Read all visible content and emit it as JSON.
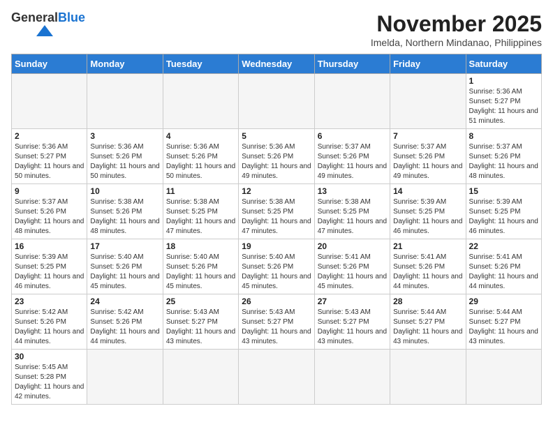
{
  "logo": {
    "text_general": "General",
    "text_blue": "Blue"
  },
  "header": {
    "month_title": "November 2025",
    "location": "Imelda, Northern Mindanao, Philippines"
  },
  "weekdays": [
    "Sunday",
    "Monday",
    "Tuesday",
    "Wednesday",
    "Thursday",
    "Friday",
    "Saturday"
  ],
  "weeks": [
    [
      {
        "day": "",
        "empty": true
      },
      {
        "day": "",
        "empty": true
      },
      {
        "day": "",
        "empty": true
      },
      {
        "day": "",
        "empty": true
      },
      {
        "day": "",
        "empty": true
      },
      {
        "day": "",
        "empty": true
      },
      {
        "day": "1",
        "sunrise": "Sunrise: 5:36 AM",
        "sunset": "Sunset: 5:27 PM",
        "daylight": "Daylight: 11 hours and 51 minutes."
      }
    ],
    [
      {
        "day": "2",
        "sunrise": "Sunrise: 5:36 AM",
        "sunset": "Sunset: 5:27 PM",
        "daylight": "Daylight: 11 hours and 50 minutes."
      },
      {
        "day": "3",
        "sunrise": "Sunrise: 5:36 AM",
        "sunset": "Sunset: 5:26 PM",
        "daylight": "Daylight: 11 hours and 50 minutes."
      },
      {
        "day": "4",
        "sunrise": "Sunrise: 5:36 AM",
        "sunset": "Sunset: 5:26 PM",
        "daylight": "Daylight: 11 hours and 50 minutes."
      },
      {
        "day": "5",
        "sunrise": "Sunrise: 5:36 AM",
        "sunset": "Sunset: 5:26 PM",
        "daylight": "Daylight: 11 hours and 49 minutes."
      },
      {
        "day": "6",
        "sunrise": "Sunrise: 5:37 AM",
        "sunset": "Sunset: 5:26 PM",
        "daylight": "Daylight: 11 hours and 49 minutes."
      },
      {
        "day": "7",
        "sunrise": "Sunrise: 5:37 AM",
        "sunset": "Sunset: 5:26 PM",
        "daylight": "Daylight: 11 hours and 49 minutes."
      },
      {
        "day": "8",
        "sunrise": "Sunrise: 5:37 AM",
        "sunset": "Sunset: 5:26 PM",
        "daylight": "Daylight: 11 hours and 48 minutes."
      }
    ],
    [
      {
        "day": "9",
        "sunrise": "Sunrise: 5:37 AM",
        "sunset": "Sunset: 5:26 PM",
        "daylight": "Daylight: 11 hours and 48 minutes."
      },
      {
        "day": "10",
        "sunrise": "Sunrise: 5:38 AM",
        "sunset": "Sunset: 5:26 PM",
        "daylight": "Daylight: 11 hours and 48 minutes."
      },
      {
        "day": "11",
        "sunrise": "Sunrise: 5:38 AM",
        "sunset": "Sunset: 5:25 PM",
        "daylight": "Daylight: 11 hours and 47 minutes."
      },
      {
        "day": "12",
        "sunrise": "Sunrise: 5:38 AM",
        "sunset": "Sunset: 5:25 PM",
        "daylight": "Daylight: 11 hours and 47 minutes."
      },
      {
        "day": "13",
        "sunrise": "Sunrise: 5:38 AM",
        "sunset": "Sunset: 5:25 PM",
        "daylight": "Daylight: 11 hours and 47 minutes."
      },
      {
        "day": "14",
        "sunrise": "Sunrise: 5:39 AM",
        "sunset": "Sunset: 5:25 PM",
        "daylight": "Daylight: 11 hours and 46 minutes."
      },
      {
        "day": "15",
        "sunrise": "Sunrise: 5:39 AM",
        "sunset": "Sunset: 5:25 PM",
        "daylight": "Daylight: 11 hours and 46 minutes."
      }
    ],
    [
      {
        "day": "16",
        "sunrise": "Sunrise: 5:39 AM",
        "sunset": "Sunset: 5:25 PM",
        "daylight": "Daylight: 11 hours and 46 minutes."
      },
      {
        "day": "17",
        "sunrise": "Sunrise: 5:40 AM",
        "sunset": "Sunset: 5:26 PM",
        "daylight": "Daylight: 11 hours and 45 minutes."
      },
      {
        "day": "18",
        "sunrise": "Sunrise: 5:40 AM",
        "sunset": "Sunset: 5:26 PM",
        "daylight": "Daylight: 11 hours and 45 minutes."
      },
      {
        "day": "19",
        "sunrise": "Sunrise: 5:40 AM",
        "sunset": "Sunset: 5:26 PM",
        "daylight": "Daylight: 11 hours and 45 minutes."
      },
      {
        "day": "20",
        "sunrise": "Sunrise: 5:41 AM",
        "sunset": "Sunset: 5:26 PM",
        "daylight": "Daylight: 11 hours and 45 minutes."
      },
      {
        "day": "21",
        "sunrise": "Sunrise: 5:41 AM",
        "sunset": "Sunset: 5:26 PM",
        "daylight": "Daylight: 11 hours and 44 minutes."
      },
      {
        "day": "22",
        "sunrise": "Sunrise: 5:41 AM",
        "sunset": "Sunset: 5:26 PM",
        "daylight": "Daylight: 11 hours and 44 minutes."
      }
    ],
    [
      {
        "day": "23",
        "sunrise": "Sunrise: 5:42 AM",
        "sunset": "Sunset: 5:26 PM",
        "daylight": "Daylight: 11 hours and 44 minutes."
      },
      {
        "day": "24",
        "sunrise": "Sunrise: 5:42 AM",
        "sunset": "Sunset: 5:26 PM",
        "daylight": "Daylight: 11 hours and 44 minutes."
      },
      {
        "day": "25",
        "sunrise": "Sunrise: 5:43 AM",
        "sunset": "Sunset: 5:27 PM",
        "daylight": "Daylight: 11 hours and 43 minutes."
      },
      {
        "day": "26",
        "sunrise": "Sunrise: 5:43 AM",
        "sunset": "Sunset: 5:27 PM",
        "daylight": "Daylight: 11 hours and 43 minutes."
      },
      {
        "day": "27",
        "sunrise": "Sunrise: 5:43 AM",
        "sunset": "Sunset: 5:27 PM",
        "daylight": "Daylight: 11 hours and 43 minutes."
      },
      {
        "day": "28",
        "sunrise": "Sunrise: 5:44 AM",
        "sunset": "Sunset: 5:27 PM",
        "daylight": "Daylight: 11 hours and 43 minutes."
      },
      {
        "day": "29",
        "sunrise": "Sunrise: 5:44 AM",
        "sunset": "Sunset: 5:27 PM",
        "daylight": "Daylight: 11 hours and 43 minutes."
      }
    ],
    [
      {
        "day": "30",
        "sunrise": "Sunrise: 5:45 AM",
        "sunset": "Sunset: 5:28 PM",
        "daylight": "Daylight: 11 hours and 42 minutes."
      },
      {
        "day": "",
        "empty": true
      },
      {
        "day": "",
        "empty": true
      },
      {
        "day": "",
        "empty": true
      },
      {
        "day": "",
        "empty": true
      },
      {
        "day": "",
        "empty": true
      },
      {
        "day": "",
        "empty": true
      }
    ]
  ]
}
